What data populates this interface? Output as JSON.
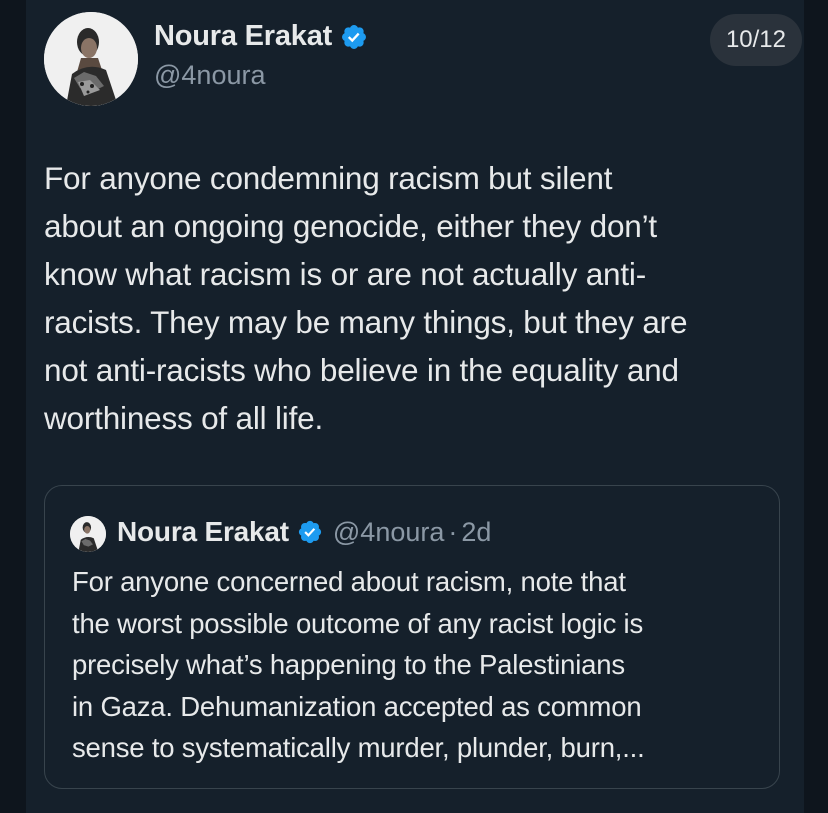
{
  "tweet": {
    "author_name": "Noura Erakat",
    "author_handle": "@4noura",
    "verified_icon": "verified-badge-icon",
    "counter": "10/12",
    "text_lines": [
      "For anyone condemning racism but  silent",
      "about an ongoing genocide, either they don’t",
      "know what racism is or are not actually anti-",
      "racists. They may be many things, but they are",
      "not anti-racists who believe in the equality and",
      "worthiness of all life."
    ]
  },
  "quoted_tweet": {
    "author_name": "Noura Erakat",
    "author_handle": "@4noura",
    "separator": "·",
    "time": "2d",
    "text_lines": [
      "For anyone concerned about racism, note that",
      "the worst possible outcome of any racist logic is",
      "precisely what’s happening to the Palestinians",
      "in Gaza. Dehumanization accepted as common",
      "sense to systematically murder, plunder, burn,..."
    ]
  },
  "colors": {
    "background": "#15202b",
    "text_primary": "#e7e9ea",
    "text_secondary": "#8b98a5",
    "verified_blue": "#1d9bf0",
    "border": "#38444d"
  }
}
